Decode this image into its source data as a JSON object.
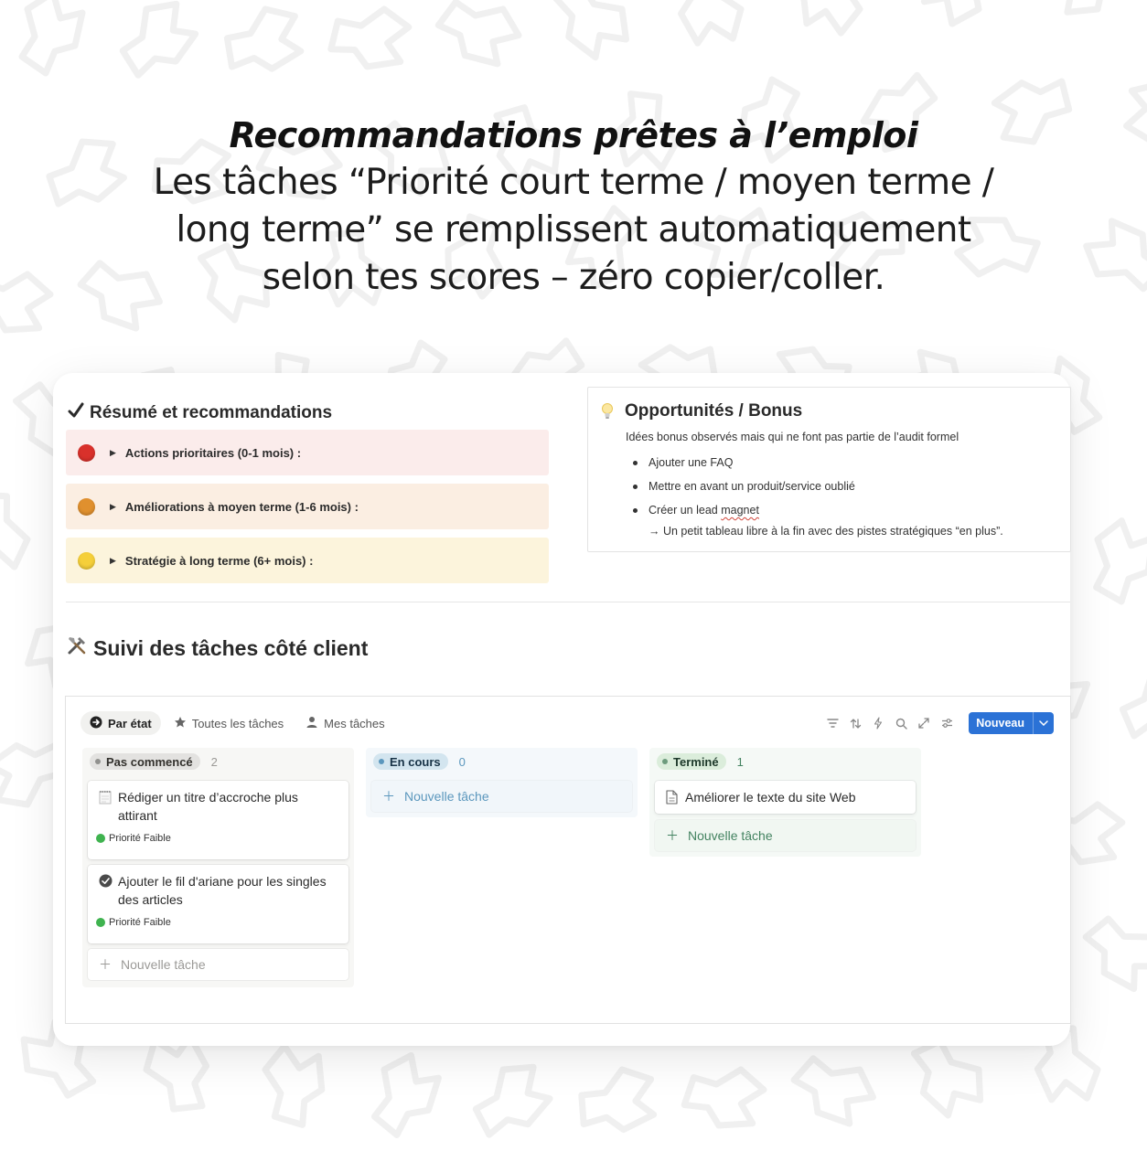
{
  "headline": {
    "title": "Recommandations prêtes à l’emploi",
    "subtitle": "Les tâches “Priorité court terme / moyen terme / long terme” se remplissent automatiquement selon tes scores – zéro copier/coller."
  },
  "summary": {
    "title": "Résumé et recommandations",
    "items": [
      {
        "label": "Actions prioritaires (0-1 mois) :",
        "dot_color": "#d9312b",
        "bg": "#fbeceb"
      },
      {
        "label": "Améliorations à moyen terme (1-6 mois) :",
        "dot_color": "#e0902e",
        "bg": "#fbeee2"
      },
      {
        "label": "Stratégie à long terme (6+ mois) :",
        "dot_color": "#f5cf3a",
        "bg": "#fcf4dc"
      }
    ]
  },
  "opportunities": {
    "title": "Opportunités / Bonus",
    "intro": "Idées bonus observés mais qui ne font pas partie de l’audit formel",
    "items": [
      "Ajouter une FAQ",
      "Mettre en avant un produit/service oublié",
      "Créer un lead "
    ],
    "item3_underlined": "magnet",
    "note": "→ Un petit tableau libre à la fin avec des pistes stratégiques “en plus”."
  },
  "tracking": {
    "title": "Suivi des tâches côté client",
    "tabs": [
      "Par état",
      "Toutes les tâches",
      "Mes tâches"
    ],
    "new_button": "Nouveau",
    "columns": [
      {
        "status": "Pas commencé",
        "count": "2",
        "tasks": [
          {
            "title": "Rédiger un titre d’accroche plus attirant",
            "priority": "Priorité Faible",
            "icon": "notepad-icon"
          },
          {
            "title": "Ajouter le fil d'ariane pour les singles des articles",
            "priority": "Priorité Faible",
            "icon": "check-circle-icon"
          }
        ],
        "add_label": "Nouvelle tâche"
      },
      {
        "status": "En cours",
        "count": "0",
        "tasks": [],
        "add_label": "Nouvelle tâche"
      },
      {
        "status": "Terminé",
        "count": "1",
        "tasks": [
          {
            "title": "Améliorer le texte du site Web",
            "icon": "page-icon"
          }
        ],
        "add_label": "Nouvelle tâche"
      }
    ]
  },
  "colors": {
    "accent_blue": "#2b72d6",
    "green": "#448361",
    "blue_status": "#337ea9",
    "gray_status": "#787774"
  }
}
